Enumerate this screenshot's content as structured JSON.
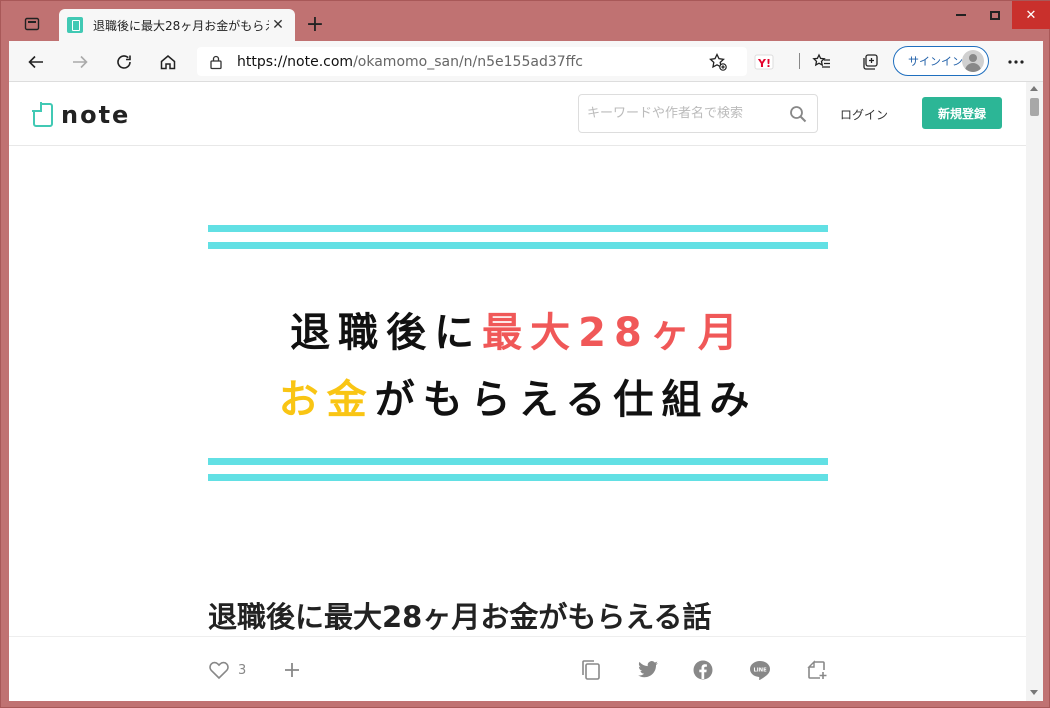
{
  "browser": {
    "tab": {
      "title": "退職後に最大28ヶ月お金がもらえる話",
      "close_label": "✕"
    },
    "newtab_label": "+",
    "window": {
      "close_label": "✕"
    },
    "address": {
      "host": "https://note.com",
      "path": "/okamomo_san/n/n5e155ad37ffc"
    },
    "signin_label": "サインイン"
  },
  "note": {
    "logo_text": "note",
    "search_placeholder": "キーワードや作者名で検索",
    "login_label": "ログイン",
    "signup_label": "新規登録"
  },
  "hero": {
    "line1": [
      {
        "text": "退職後に",
        "color": "black"
      },
      {
        "text": "最大28ヶ月",
        "color": "red"
      }
    ],
    "line2": [
      {
        "text": "お金",
        "color": "yellow"
      },
      {
        "text": "がもらえる仕組み",
        "color": "black"
      }
    ]
  },
  "article": {
    "title": "退職後に最大28ヶ月お金がもらえる話",
    "like_count": "3"
  },
  "colors": {
    "accent": "#2cb696",
    "stripe": "#62e0e4",
    "hero_red": "#f05858",
    "hero_yellow": "#f9c514"
  }
}
